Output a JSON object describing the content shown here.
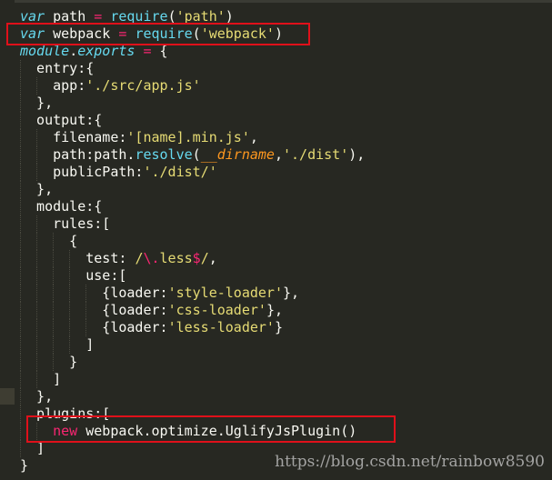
{
  "code": {
    "lines": [
      [
        {
          "t": "var",
          "c": "kw-var"
        },
        {
          "t": " path ",
          "c": "prop"
        },
        {
          "t": "=",
          "c": "op"
        },
        {
          "t": " ",
          "c": "prop"
        },
        {
          "t": "require",
          "c": "fn"
        },
        {
          "t": "(",
          "c": "punct"
        },
        {
          "t": "'path'",
          "c": "str"
        },
        {
          "t": ")",
          "c": "punct"
        }
      ],
      [
        {
          "t": "var",
          "c": "kw-var"
        },
        {
          "t": " webpack ",
          "c": "prop"
        },
        {
          "t": "=",
          "c": "op"
        },
        {
          "t": " ",
          "c": "prop"
        },
        {
          "t": "require",
          "c": "fn"
        },
        {
          "t": "(",
          "c": "punct"
        },
        {
          "t": "'webpack'",
          "c": "str"
        },
        {
          "t": ")",
          "c": "punct"
        }
      ],
      [
        {
          "t": "module",
          "c": "obj"
        },
        {
          "t": ".",
          "c": "punct"
        },
        {
          "t": "exports",
          "c": "obj"
        },
        {
          "t": " ",
          "c": "prop"
        },
        {
          "t": "=",
          "c": "op"
        },
        {
          "t": " {",
          "c": "punct"
        }
      ],
      [
        {
          "t": "  entry:{",
          "c": "prop"
        }
      ],
      [
        {
          "t": "    app:",
          "c": "prop"
        },
        {
          "t": "'./src/app.js'",
          "c": "str"
        }
      ],
      [
        {
          "t": "  },",
          "c": "prop"
        }
      ],
      [
        {
          "t": "  output:{",
          "c": "prop"
        }
      ],
      [
        {
          "t": "    filename:",
          "c": "prop"
        },
        {
          "t": "'[name].min.js'",
          "c": "str"
        },
        {
          "t": ",",
          "c": "punct"
        }
      ],
      [
        {
          "t": "    path:path.",
          "c": "prop"
        },
        {
          "t": "resolve",
          "c": "fn"
        },
        {
          "t": "(",
          "c": "punct"
        },
        {
          "t": "__dirname",
          "c": "dirname"
        },
        {
          "t": ",",
          "c": "punct"
        },
        {
          "t": "'./dist'",
          "c": "str"
        },
        {
          "t": "),",
          "c": "punct"
        }
      ],
      [
        {
          "t": "    publicPath:",
          "c": "prop"
        },
        {
          "t": "'./dist/'",
          "c": "str"
        }
      ],
      [
        {
          "t": "  },",
          "c": "prop"
        }
      ],
      [
        {
          "t": "  module:{",
          "c": "prop"
        }
      ],
      [
        {
          "t": "    rules:[",
          "c": "prop"
        }
      ],
      [
        {
          "t": "      {",
          "c": "prop"
        }
      ],
      [
        {
          "t": "        test: ",
          "c": "prop"
        },
        {
          "t": "/",
          "c": "regex"
        },
        {
          "t": "\\.",
          "c": "regex-op"
        },
        {
          "t": "less",
          "c": "regex"
        },
        {
          "t": "$",
          "c": "regex-op"
        },
        {
          "t": "/",
          "c": "regex"
        },
        {
          "t": ",",
          "c": "punct"
        }
      ],
      [
        {
          "t": "        use:[",
          "c": "prop"
        }
      ],
      [
        {
          "t": "          {loader:",
          "c": "prop"
        },
        {
          "t": "'style-loader'",
          "c": "str"
        },
        {
          "t": "},",
          "c": "punct"
        }
      ],
      [
        {
          "t": "          {loader:",
          "c": "prop"
        },
        {
          "t": "'css-loader'",
          "c": "str"
        },
        {
          "t": "},",
          "c": "punct"
        }
      ],
      [
        {
          "t": "          {loader:",
          "c": "prop"
        },
        {
          "t": "'less-loader'",
          "c": "str"
        },
        {
          "t": "}",
          "c": "punct"
        }
      ],
      [
        {
          "t": "        ]",
          "c": "prop"
        }
      ],
      [
        {
          "t": "      }",
          "c": "prop"
        }
      ],
      [
        {
          "t": "    ]",
          "c": "prop"
        }
      ],
      [
        {
          "t": "  },",
          "c": "prop"
        }
      ],
      [
        {
          "t": "  plugins:[",
          "c": "prop"
        }
      ],
      [
        {
          "t": "    ",
          "c": "prop"
        },
        {
          "t": "new",
          "c": "kw-new"
        },
        {
          "t": " webpack.optimize.UglifyJsPlugin()",
          "c": "prop"
        }
      ],
      [
        {
          "t": "  ]",
          "c": "prop"
        }
      ],
      [
        {
          "t": "}",
          "c": "prop"
        }
      ]
    ]
  },
  "watermark": {
    "text": "https://blog.csdn.net/rainbow8590"
  },
  "colors": {
    "background": "#272822",
    "highlight_border": "#e0101a",
    "string": "#e6db74",
    "keyword": "#66d9ef",
    "operator": "#f92672",
    "text": "#f8f8f2"
  }
}
